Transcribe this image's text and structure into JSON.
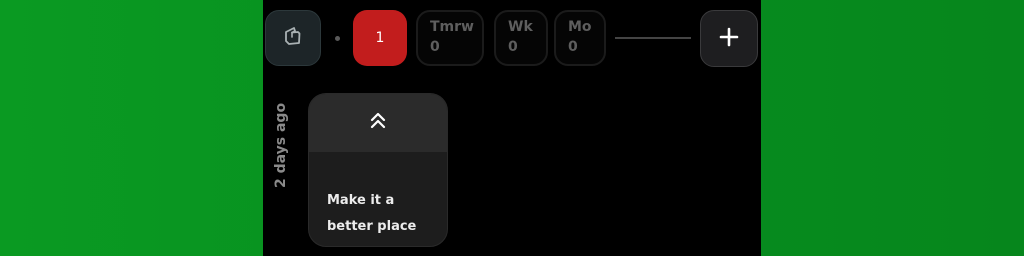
{
  "topbar": {
    "tag_icon": "tag-icon",
    "today_count": "1",
    "tomorrow": {
      "label": "Tmrw",
      "count": "0"
    },
    "week": {
      "label": "Wk",
      "count": "0"
    },
    "month": {
      "label": "Mo",
      "count": "0"
    },
    "add_icon": "plus-icon"
  },
  "timeline": {
    "group_label": "2 days ago",
    "card": {
      "expand_icon": "double-chevron-up-icon",
      "text": "Make it a better place"
    }
  },
  "colors": {
    "background": "#078f1f",
    "today_badge": "#c21d1d",
    "surface": "#000000"
  }
}
